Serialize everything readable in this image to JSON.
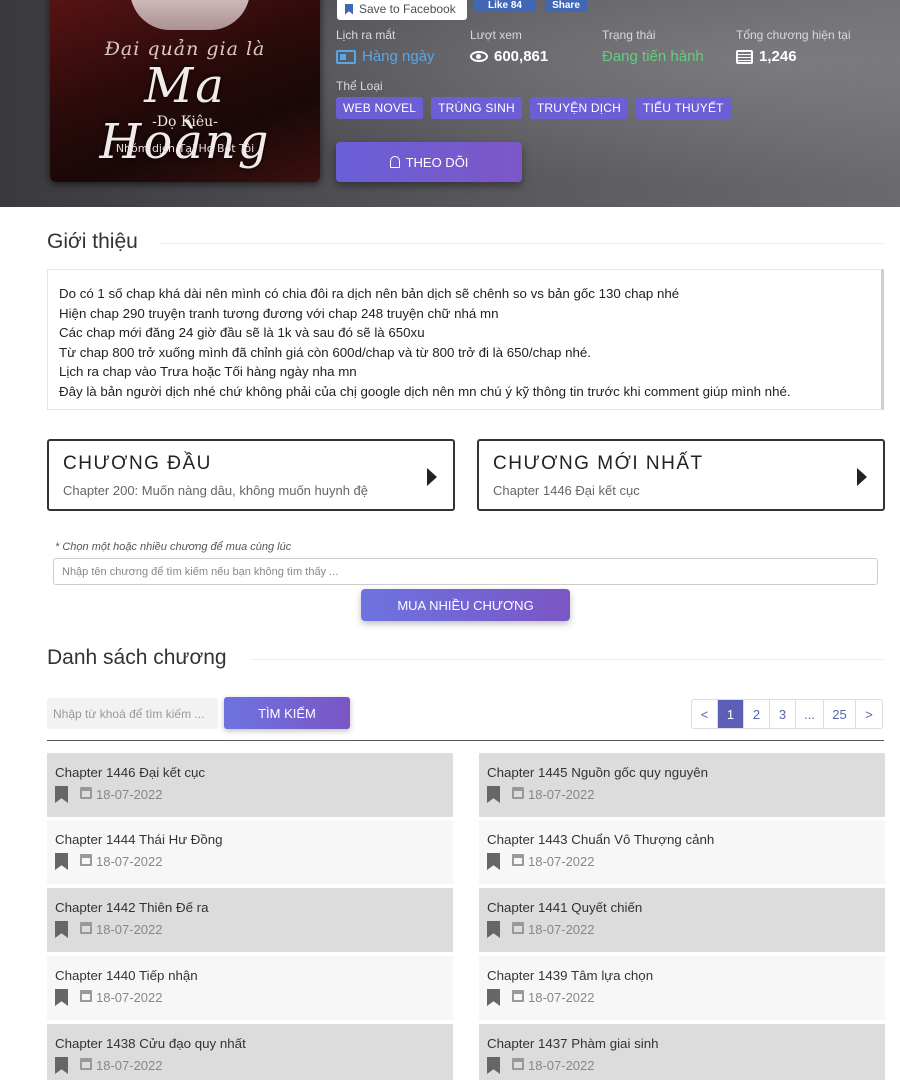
{
  "header": {
    "cover": {
      "title_line1": "Đại quản gia là",
      "title_line2": "Ma Hoàng",
      "author": "-Dọ Kiêu-",
      "group": "Nhóm dịch Tại Họ Bốt Tôi"
    },
    "facebook": {
      "save_label": "Save to Facebook",
      "like_label": "Like 84",
      "share_label": "Share"
    },
    "stats": [
      {
        "label": "Lịch ra mắt",
        "value": "Hàng ngày",
        "icon": "calendar-icon",
        "color": "#58a6e6"
      },
      {
        "label": "Lượt xem",
        "value": "600,861",
        "icon": "eye-icon",
        "color": "#ffffff"
      },
      {
        "label": "Trạng thái",
        "value": "Đang tiến hành",
        "icon": "",
        "color": "#5fd07a"
      },
      {
        "label": "Tổng chương hiện tại",
        "value": "1,246",
        "icon": "list-icon",
        "color": "#ffffff"
      }
    ],
    "genre_label": "Thể Loại",
    "genres": [
      "WEB NOVEL",
      "TRÙNG SINH",
      "TRUYỆN DỊCH",
      "TIỂU THUYẾT"
    ],
    "follow_label": "THEO DÕI"
  },
  "intro": {
    "heading": "Giới thiệu",
    "lines": [
      "Do có 1 số chap khá dài nên mình có chia đôi ra dịch nên bản dịch sẽ chênh so vs bản gốc 130 chap nhé",
      "Hiện chap 290 truyện tranh tương đương với chap 248 truyện chữ nhá mn",
      "Các chap mới đăng 24 giờ đầu sẽ là 1k và sau đó sẽ là 650xu",
      "Từ  chap 800 trở xuống mình đã chỉnh giá còn 600d/chap và từ 800 trở đi là 650/chap nhé.",
      "Lịch ra chap vào Trưa hoặc Tối hàng ngày nha mn",
      "Đây là bản người dịch nhé chứ không phải của chị google dịch nên mn chú ý kỹ thông tin trước khi comment giúp mình nhé."
    ]
  },
  "first_chapter": {
    "caption": "CHƯƠNG ĐẦU",
    "name": "Chapter 200: Muốn nàng dâu, không muốn huynh đệ"
  },
  "latest_chapter": {
    "caption": "CHƯƠNG MỚI NHẤT",
    "name": "Chapter 1446 Đại kết cục"
  },
  "buy": {
    "note": "* Chọn một hoặc nhiều chương để mua cùng lúc",
    "placeholder": "Nhập tên chương để tìm kiếm nếu bạn không tìm thấy ...",
    "button": "MUA NHIỀU CHƯƠNG"
  },
  "chapter_list": {
    "heading": "Danh sách chương",
    "search_placeholder": "Nhập từ khoá để tìm kiếm ...",
    "search_button": "TÌM KIẾM",
    "pagination": [
      "<",
      "1",
      "2",
      "3",
      "...",
      "25",
      ">"
    ],
    "current_page": "1",
    "rows": [
      {
        "title": "Chapter 1446 Đại kết cục",
        "date": "18-07-2022"
      },
      {
        "title": "Chapter 1445 Nguồn gốc quy nguyên",
        "date": "18-07-2022"
      },
      {
        "title": "Chapter 1444 Thái Hư Đồng",
        "date": "18-07-2022"
      },
      {
        "title": "Chapter 1443 Chuẩn Vô Thượng cảnh",
        "date": "18-07-2022"
      },
      {
        "title": "Chapter 1442 Thiên Đế ra",
        "date": "18-07-2022"
      },
      {
        "title": "Chapter 1441 Quyết chiến",
        "date": "18-07-2022"
      },
      {
        "title": "Chapter 1440 Tiếp nhận",
        "date": "18-07-2022"
      },
      {
        "title": "Chapter 1439 Tâm lựa chọn",
        "date": "18-07-2022"
      },
      {
        "title": "Chapter 1438 Cửu đạo quy nhất",
        "date": "18-07-2022"
      },
      {
        "title": "Chapter 1437 Phàm giai sinh",
        "date": "18-07-2022"
      }
    ]
  },
  "colors": {
    "accent": "#6c5fd6",
    "status_green": "#5fd07a",
    "link_blue": "#58a6e6"
  }
}
